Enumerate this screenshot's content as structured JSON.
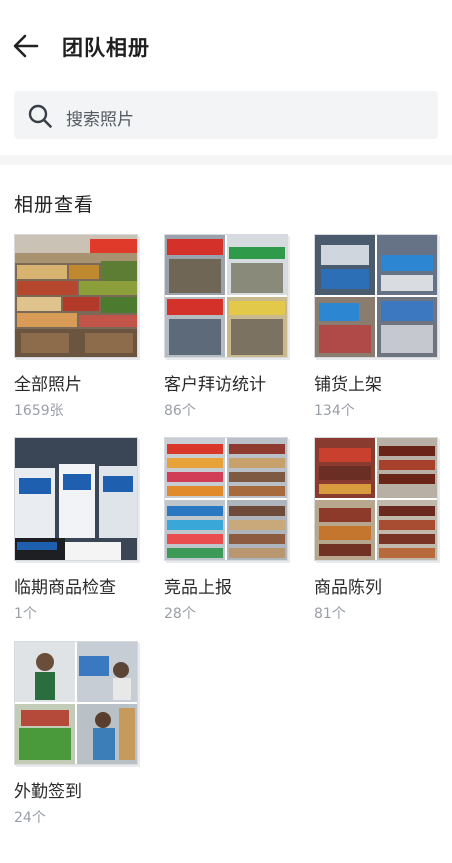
{
  "header": {
    "title": "团队相册",
    "back_icon": "arrow-left-icon"
  },
  "search": {
    "placeholder": "搜索照片",
    "icon": "search-icon"
  },
  "section": {
    "title": "相册查看"
  },
  "albums": [
    {
      "name": "全部照片",
      "count": "1659张"
    },
    {
      "name": "客户拜访统计",
      "count": "86个"
    },
    {
      "name": "铺货上架",
      "count": "134个"
    },
    {
      "name": "临期商品检查",
      "count": "1个"
    },
    {
      "name": "竞品上报",
      "count": "28个"
    },
    {
      "name": "商品陈列",
      "count": "81个"
    },
    {
      "name": "外勤签到",
      "count": "24个"
    }
  ]
}
